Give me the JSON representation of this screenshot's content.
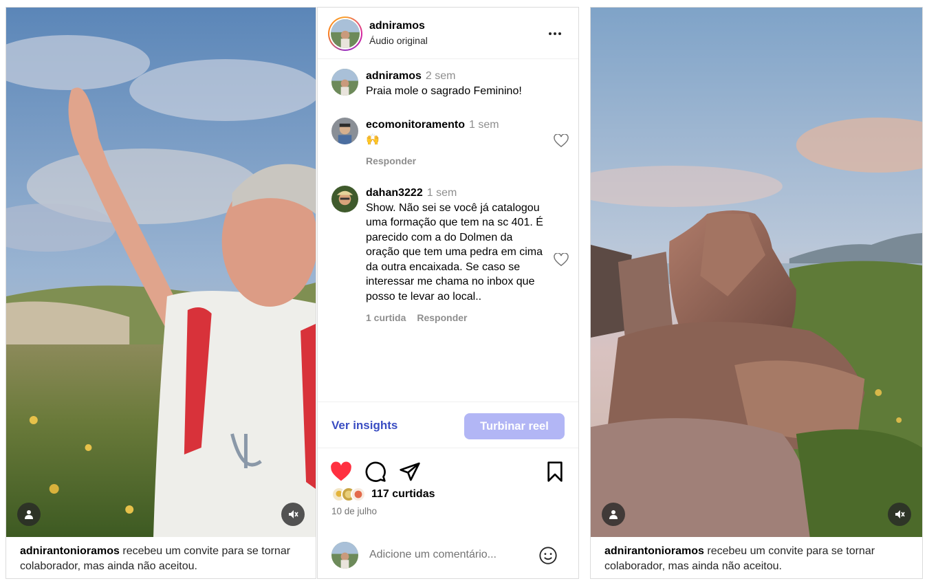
{
  "left_reel": {
    "invite_user": "adnirantonioramos",
    "invite_message": "recebeu um convite para se tornar colaborador, mas ainda não aceitou.",
    "user_tag_icon": "person-icon",
    "mute_icon": "speaker-muted-icon"
  },
  "post": {
    "username": "adniramos",
    "audio": "Áudio original",
    "comments": [
      {
        "user": "adniramos",
        "time": "2 sem",
        "text": "Praia mole o sagrado Feminino!"
      },
      {
        "user": "ecomonitoramento",
        "time": "1 sem",
        "text": "🙌",
        "reply": "Responder"
      },
      {
        "user": "dahan3222",
        "time": "1 sem",
        "text": "Show. Não sei se você já catalogou uma formação que tem na sc 401. É parecido com a do Dolmen da oração que tem uma pedra em cima da outra encaixada. Se caso se interessar me chama no inbox que posso te levar ao local..",
        "likes": "1 curtida",
        "reply": "Responder"
      }
    ],
    "insights_label": "Ver insights",
    "boost_label": "Turbinar reel",
    "likes_count": "117 curtidas",
    "date": "10 de julho",
    "comment_placeholder": "Adicione um comentário...",
    "colors": {
      "like": "#ff3040",
      "link": "#3a4dc2",
      "boost": "#b2b6f5"
    }
  },
  "right_reel": {
    "invite_user": "adnirantonioramos",
    "invite_message": "recebeu um convite para se tornar colaborador, mas ainda não aceitou.",
    "user_tag_icon": "person-icon",
    "mute_icon": "speaker-muted-icon"
  }
}
